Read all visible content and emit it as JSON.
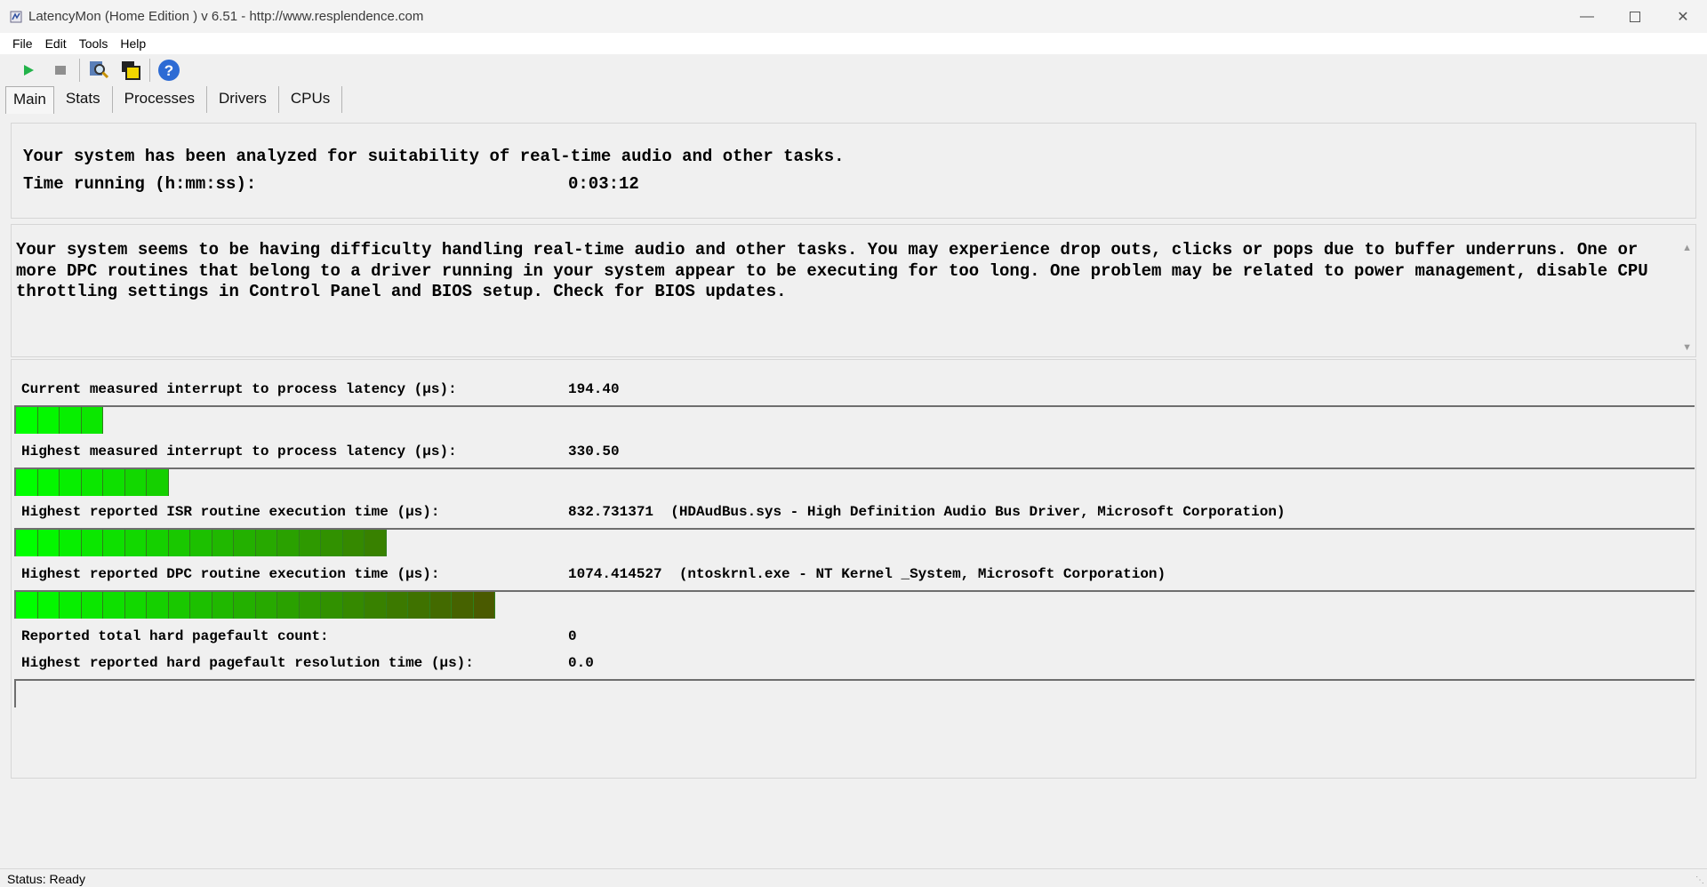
{
  "window": {
    "title": "LatencyMon  (Home Edition )  v 6.51 - http://www.resplendence.com",
    "controls": [
      "minimize-icon",
      "maximize-icon",
      "close-icon"
    ]
  },
  "menu": [
    "File",
    "Edit",
    "Tools",
    "Help"
  ],
  "toolbar": [
    "play-icon",
    "stop-icon",
    "search-icon",
    "windows-icon",
    "help-icon"
  ],
  "tabs": [
    "Main",
    "Stats",
    "Processes",
    "Drivers",
    "CPUs"
  ],
  "summary": {
    "line1": "Your system has been analyzed for suitability of real-time audio and other tasks.",
    "time_label": "Time running (h:mm:ss):",
    "time_value": "0:03:12"
  },
  "message": "Your system seems to be having difficulty handling real-time audio and other tasks. You may experience drop outs, clicks or pops due to buffer underruns. One or more DPC routines that belong to a driver running in your system appear to be executing for too long. One problem may be related to power management, disable CPU throttling settings in Control Panel and BIOS setup. Check for BIOS updates.",
  "metrics": [
    {
      "label": "Current measured interrupt to process latency (µs):",
      "value": "194.40",
      "note": "",
      "fill_segments": 4
    },
    {
      "label": "Highest measured interrupt to process latency (µs):",
      "value": "330.50",
      "note": "",
      "fill_segments": 7
    },
    {
      "label": "Highest reported ISR routine execution time (µs):",
      "value": "832.731371",
      "note": "(HDAudBus.sys - High Definition Audio Bus Driver, Microsoft Corporation)",
      "fill_segments": 17
    },
    {
      "label": "Highest reported DPC routine execution time (µs):",
      "value": "1074.414527",
      "note": "(ntoskrnl.exe - NT Kernel _System, Microsoft Corporation)",
      "fill_segments": 22
    },
    {
      "label": "Reported total hard pagefault count:",
      "value": "0",
      "note": ""
    },
    {
      "label": "Highest reported hard pagefault resolution time (µs):",
      "value": "0.0",
      "note": "",
      "fill_segments": 0
    }
  ],
  "status": "Status: Ready",
  "colors": {
    "meter_start": "#00ff00",
    "meter_end": "#4a5a00"
  }
}
